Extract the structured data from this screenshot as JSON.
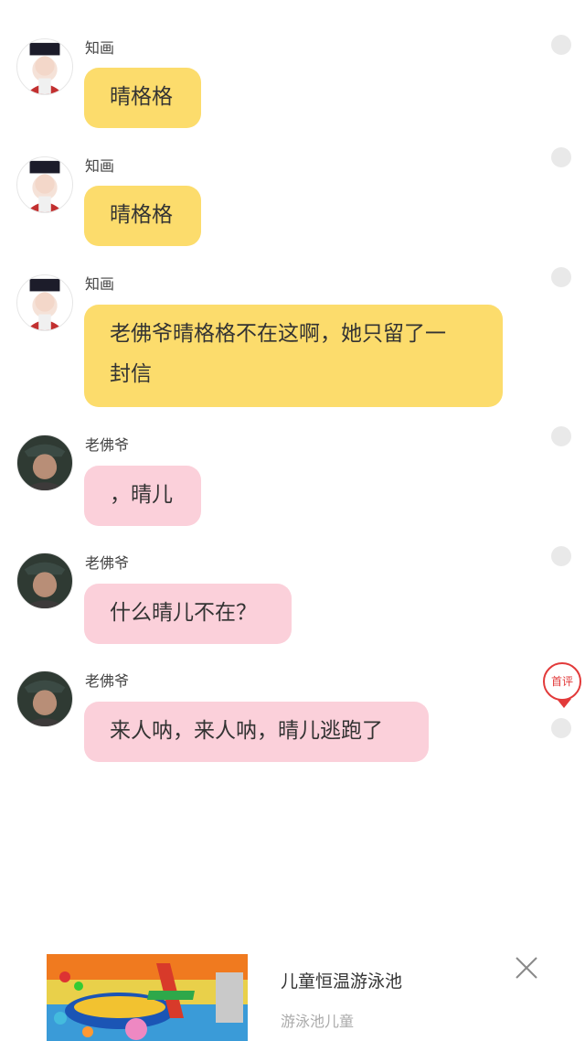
{
  "messages": [
    {
      "sender": "知画",
      "text": "晴格格",
      "avatar": "zhihua-avatar",
      "bubble_color": "#fcdc6c"
    },
    {
      "sender": "知画",
      "text": "晴格格",
      "avatar": "zhihua-avatar",
      "bubble_color": "#fcdc6c"
    },
    {
      "sender": "知画",
      "text": "老佛爷晴格格不在这啊，她只留了一\n封信",
      "avatar": "zhihua-avatar",
      "bubble_color": "#fcdc6c"
    },
    {
      "sender": "老佛爷",
      "text": "，晴儿",
      "avatar": "laofoye-avatar",
      "bubble_color": "#fbd0da"
    },
    {
      "sender": "老佛爷",
      "text": "什么晴儿不在？",
      "avatar": "laofoye-avatar",
      "bubble_color": "#fbd0da"
    },
    {
      "sender": "老佛爷",
      "text": "来人呐，来人呐，晴儿逃跑了",
      "avatar": "laofoye-avatar",
      "bubble_color": "#fbd0da"
    }
  ],
  "review_badge": {
    "label": "首评",
    "color": "#e23a3a"
  },
  "ad": {
    "title": "儿童恒温游泳池",
    "subtitle": "游泳池儿童",
    "close_icon": "close-icon"
  }
}
